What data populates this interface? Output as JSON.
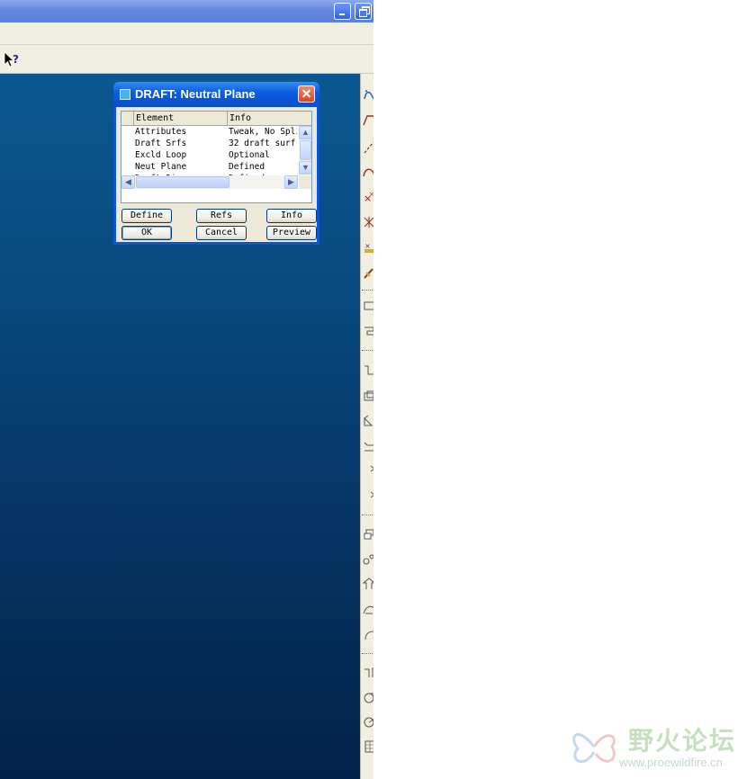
{
  "dialog": {
    "title": "DRAFT: Neutral Plane",
    "columns": {
      "element": "Element",
      "info": "Info"
    },
    "rows": [
      {
        "element": "Attributes",
        "info": "Tweak, No Split"
      },
      {
        "element": "Draft Srfs",
        "info": "32 draft surf"
      },
      {
        "element": "Excld Loop",
        "info": "Optional"
      },
      {
        "element": "Neut Plane",
        "info": "Defined"
      },
      {
        "element": "Draft Dir",
        "info": "Defined"
      }
    ],
    "buttons": {
      "define": "Define",
      "refs": "Refs",
      "info": "Info",
      "ok": "OK",
      "cancel": "Cancel",
      "preview": "Preview"
    }
  },
  "watermark": {
    "text": "野火论坛",
    "url": "www.proewildfire.cn"
  },
  "colors": {
    "viewport_top": "#0a5891",
    "viewport_bottom": "#03214a",
    "dialog_frame": "#0b55d6",
    "close_button": "#d6481f"
  }
}
